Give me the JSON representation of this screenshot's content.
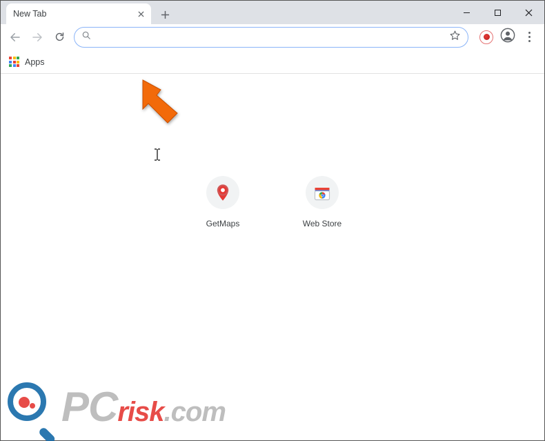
{
  "tab": {
    "title": "New Tab"
  },
  "omnibox": {
    "value": ""
  },
  "bookmarks": {
    "apps_label": "Apps"
  },
  "shortcuts": [
    {
      "label": "GetMaps"
    },
    {
      "label": "Web Store"
    }
  ],
  "watermark": {
    "pc": "PC",
    "risk": "risk",
    "com": ".com"
  }
}
